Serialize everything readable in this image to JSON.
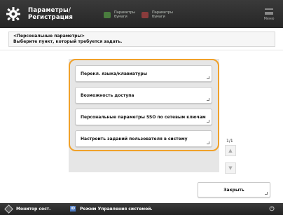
{
  "header": {
    "title": "Параметры/\nРегистрация",
    "pill_green": "Параметры\nбумаги",
    "pill_red": "Параметры\nбумаги",
    "menu_label": "Меню"
  },
  "heading": {
    "line1": "<Персональные параметры>",
    "line2": "Выберите пункт, который требуется задать."
  },
  "items": [
    {
      "label": "Перекл. языка/клавиатуры"
    },
    {
      "label": "Возможность доступа"
    },
    {
      "label": "Персональные параметры SSO по сетевым ключам"
    },
    {
      "label": "Настроить заданий пользователя в систему"
    }
  ],
  "pagination": {
    "indicator": "1/1"
  },
  "close_button": {
    "label": "Закрыть"
  },
  "bottom_bar": {
    "monitor": "Монитор сост.",
    "mode": "Режим Управления системой."
  },
  "colors": {
    "highlight": "#f0a12a",
    "topbar": "#2e2e2e"
  }
}
